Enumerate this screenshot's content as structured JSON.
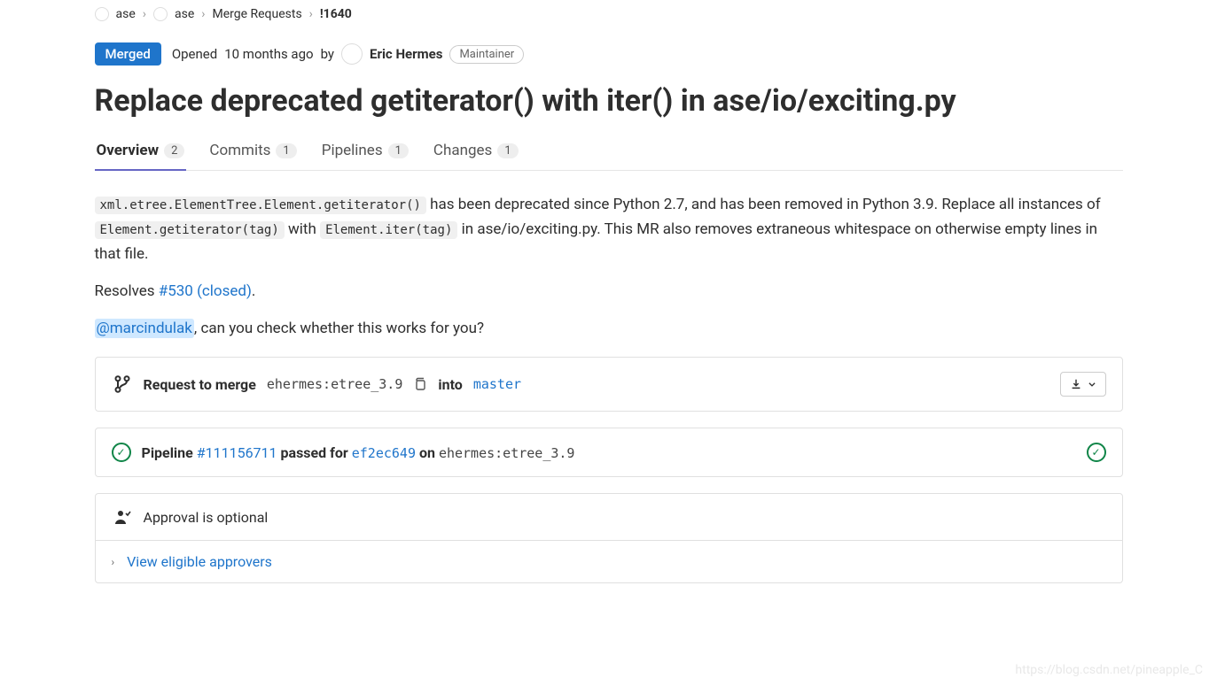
{
  "breadcrumb": {
    "group": "ase",
    "project": "ase",
    "section": "Merge Requests",
    "ref": "!1640"
  },
  "header": {
    "status": "Merged",
    "opened_prefix": "Opened",
    "opened_time": "10 months ago",
    "opened_by": "by",
    "author": "Eric Hermes",
    "role": "Maintainer"
  },
  "title": "Replace deprecated getiterator() with iter() in ase/io/exciting.py",
  "tabs": {
    "overview": {
      "label": "Overview",
      "count": "2"
    },
    "commits": {
      "label": "Commits",
      "count": "1"
    },
    "pipelines": {
      "label": "Pipelines",
      "count": "1"
    },
    "changes": {
      "label": "Changes",
      "count": "1"
    }
  },
  "description": {
    "code1": "xml.etree.ElementTree.Element.getiterator()",
    "text1": " has been deprecated since Python 2.7, and has been removed in Python 3.9. Replace all instances of ",
    "code2": "Element.getiterator(tag)",
    "text2": " with ",
    "code3": "Element.iter(tag)",
    "text3": " in ase/io/exciting.py. This MR also removes extraneous whitespace on otherwise empty lines in that file.",
    "resolves_label": "Resolves ",
    "resolves_link": "#530 (closed)",
    "resolves_suffix": ".",
    "mention": "@marcindulak",
    "mention_suffix": ", can you check whether this works for you?"
  },
  "merge_widget": {
    "request_label": "Request to merge",
    "source_branch": "ehermes:etree_3.9",
    "into_label": "into",
    "target_branch": "master"
  },
  "pipeline": {
    "label": "Pipeline ",
    "id": "#111156711",
    "passed_for": " passed for ",
    "sha": "ef2ec649",
    "on": " on ",
    "branch": "ehermes:etree_3.9"
  },
  "approval": {
    "text": "Approval is optional",
    "view_link": "View eligible approvers"
  },
  "watermark": "https://blog.csdn.net/pineapple_C"
}
